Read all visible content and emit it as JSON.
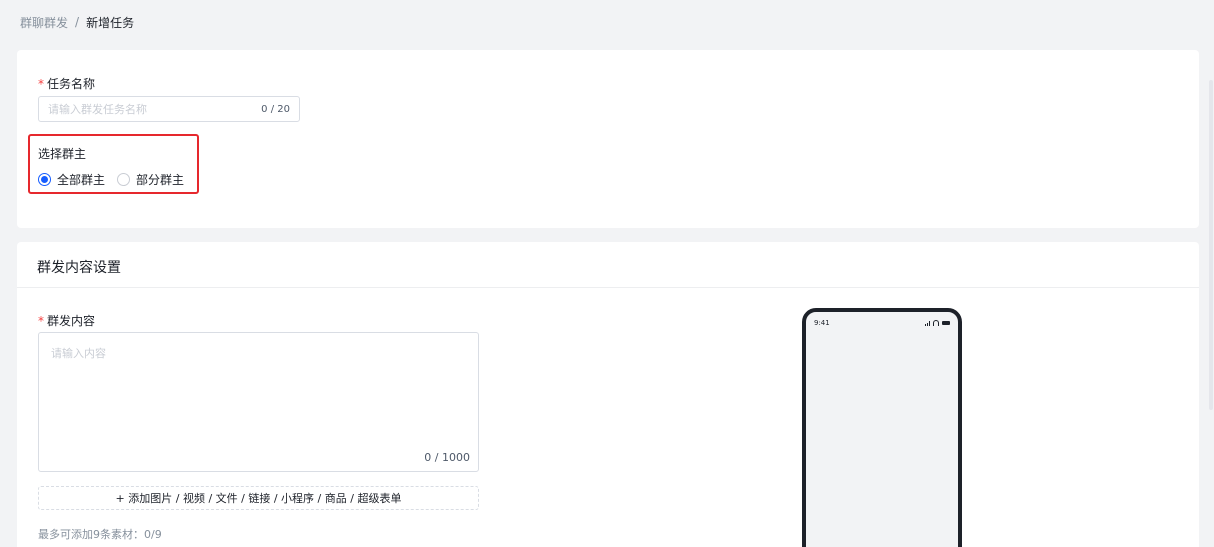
{
  "breadcrumb": {
    "parent": "群聊群发",
    "separator": "/",
    "current": "新增任务"
  },
  "task_name": {
    "required_mark": "*",
    "label": "任务名称",
    "placeholder": "请输入群发任务名称",
    "counter": "0 / 20"
  },
  "owner_select": {
    "label": "选择群主",
    "options": [
      {
        "label": "全部群主",
        "checked": true
      },
      {
        "label": "部分群主",
        "checked": false
      }
    ]
  },
  "content_section": {
    "title": "群发内容设置",
    "required_mark": "*",
    "label": "群发内容",
    "placeholder": "请输入内容",
    "counter": "0 / 1000",
    "add_button": "+ 添加图片 / 视频 / 文件 / 链接 / 小程序 / 商品 / 超级表单",
    "max_note": "最多可添加9条素材：0/9"
  },
  "phone_preview": {
    "time": "9:41"
  },
  "colors": {
    "primary": "#165dff",
    "required": "#f53f3f",
    "highlight": "#e6282d"
  }
}
